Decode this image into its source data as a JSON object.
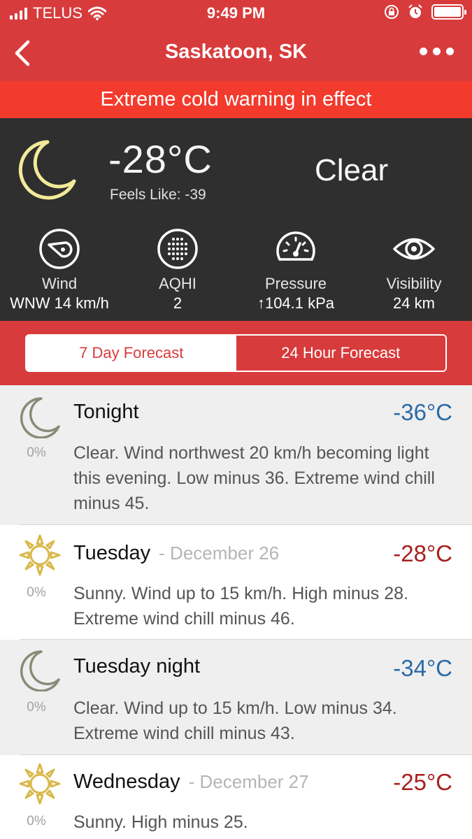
{
  "status": {
    "carrier": "TELUS",
    "time": "9:49 PM"
  },
  "nav": {
    "title": "Saskatoon, SK"
  },
  "warning": "Extreme cold warning in effect",
  "current": {
    "temperature": "-28°C",
    "feels_like": "Feels Like: -39",
    "condition": "Clear",
    "icon": "moon-icon",
    "stats": [
      {
        "label": "Wind",
        "value": "WNW 14 km/h",
        "icon": "wind-compass-icon"
      },
      {
        "label": "AQHI",
        "value": "2",
        "icon": "air-quality-icon"
      },
      {
        "label": "Pressure",
        "value": "↑104.1 kPa",
        "icon": "pressure-gauge-icon"
      },
      {
        "label": "Visibility",
        "value": "24 km",
        "icon": "eye-icon"
      }
    ]
  },
  "tabs": [
    {
      "label": "7 Day Forecast",
      "active": true
    },
    {
      "label": "24 Hour Forecast",
      "active": false
    }
  ],
  "forecast": [
    {
      "name": "Tonight",
      "date": "",
      "temp": "-36°C",
      "pop": "0%",
      "icon": "moon-icon",
      "desc": "Clear. Wind northwest 20 km/h becoming light this evening. Low minus 36. Extreme wind chill minus 45."
    },
    {
      "name": "Tuesday",
      "date": "- December 26",
      "temp": "-28°C",
      "pop": "0%",
      "icon": "sun-icon",
      "desc": "Sunny. Wind up to 15 km/h. High minus 28. Extreme wind chill minus 46."
    },
    {
      "name": "Tuesday night",
      "date": "",
      "temp": "-34°C",
      "pop": "0%",
      "icon": "moon-icon",
      "desc": "Clear. Wind up to 15 km/h. Low minus 34. Extreme wind chill minus 43."
    },
    {
      "name": "Wednesday",
      "date": "- December 27",
      "temp": "-25°C",
      "pop": "0%",
      "icon": "sun-icon",
      "desc": "Sunny. High minus 25."
    }
  ],
  "colors": {
    "brand_red": "#d83b3c",
    "warning_red": "#f23a2d",
    "panel_dark": "#2f2f2f",
    "low_temp": "#2b6aa8",
    "high_temp": "#a8201f"
  }
}
